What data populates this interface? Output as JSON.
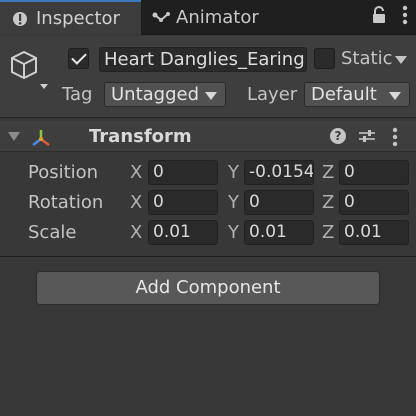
{
  "tabs": {
    "inspector": "Inspector",
    "animator": "Animator"
  },
  "header": {
    "active": true,
    "name": "Heart Danglies_Earing",
    "static_checked": false,
    "static_label": "Static",
    "tag_label": "Tag",
    "tag_value": "Untagged",
    "layer_label": "Layer",
    "layer_value": "Default"
  },
  "transform": {
    "title": "Transform",
    "help_glyph": "?",
    "rows": [
      {
        "label": "Position",
        "x": "0",
        "y": "-0.0154",
        "z": "0"
      },
      {
        "label": "Rotation",
        "x": "0",
        "y": "0",
        "z": "0"
      },
      {
        "label": "Scale",
        "x": "0.01",
        "y": "0.01",
        "z": "0.01"
      }
    ],
    "axes": {
      "x": "X",
      "y": "Y",
      "z": "Z"
    }
  },
  "add_component_label": "Add Component",
  "colors": {
    "accent": "#3a79bb",
    "background": "#383838",
    "tabbar": "#1f1f1f",
    "field": "#2a2a2a",
    "button": "#585858"
  }
}
